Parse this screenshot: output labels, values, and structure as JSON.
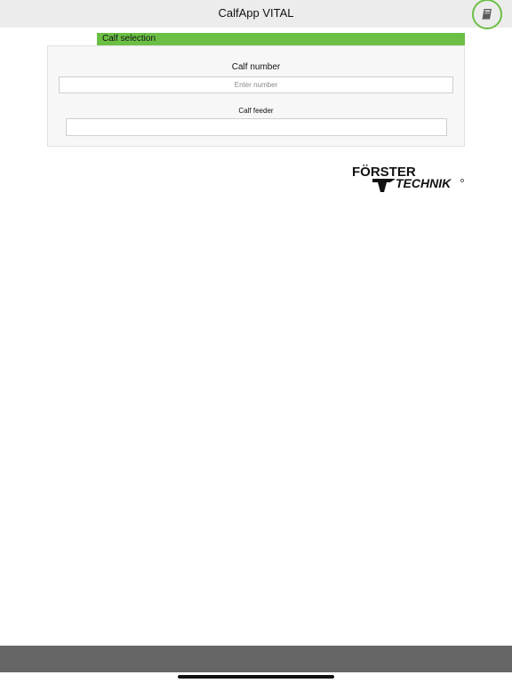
{
  "header": {
    "title": "CalfApp VITAL",
    "manual_icon": "book-icon"
  },
  "section": {
    "title": "Calf selection"
  },
  "form": {
    "calf_number": {
      "label": "Calf number",
      "placeholder": "Enter number",
      "value": ""
    },
    "calf_feeder": {
      "label": "Calf feeder",
      "value": ""
    }
  },
  "logo": {
    "line1": "FÖRSTER",
    "line2": "TECHNIK"
  },
  "colors": {
    "accent": "#6cbf45",
    "header_bg": "#ececec",
    "panel_bg": "#f7f7f7",
    "bottom_bar": "#666666"
  }
}
